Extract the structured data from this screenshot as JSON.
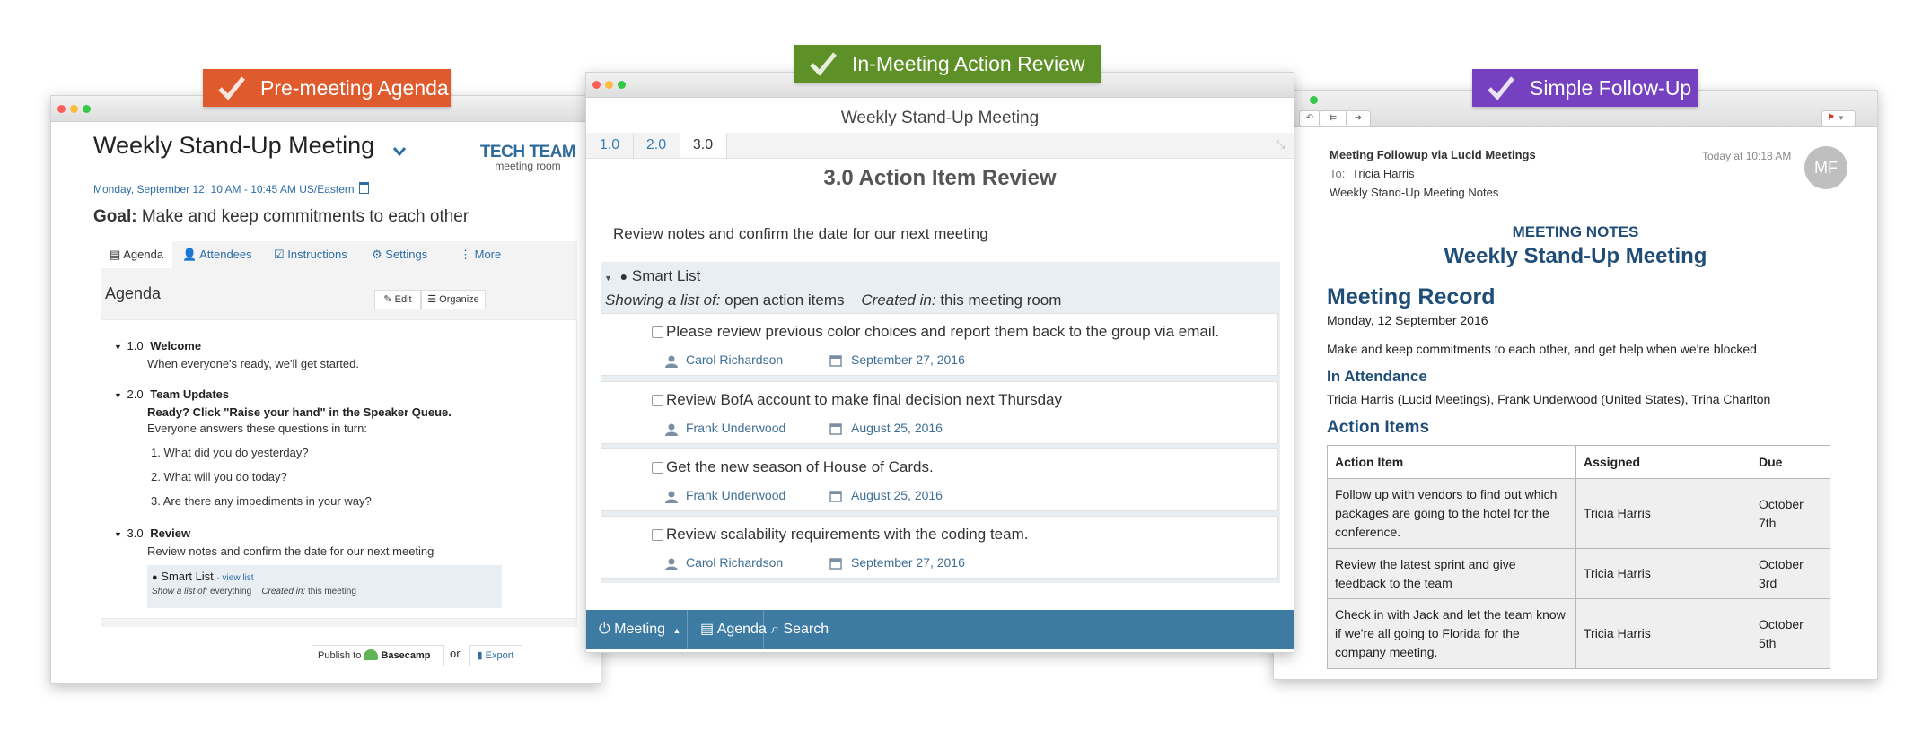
{
  "ribbons": {
    "left": {
      "label": "Pre-meeting Agenda",
      "color": "#df5a2d"
    },
    "center": {
      "label": "In-Meeting Action Review",
      "color": "#5d9026"
    },
    "right": {
      "label": "Simple Follow-Up",
      "color": "#7541c0"
    }
  },
  "agenda": {
    "title": "Weekly Stand-Up Meeting",
    "logo_main": "TECH TEAM",
    "logo_sub": "meeting room",
    "datetime": "Monday, September 12, 10 AM - 10:45 AM US/Eastern",
    "goal_label": "Goal:",
    "goal_text": "Make and keep commitments to each other",
    "tabs": [
      "Agenda",
      "Attendees",
      "Instructions",
      "Settings",
      "More"
    ],
    "panel_title": "Agenda",
    "edit_label": "Edit",
    "organize_label": "Organize",
    "items": [
      {
        "num": "1.0",
        "title": "Welcome",
        "desc": "When everyone's ready, we'll get started."
      },
      {
        "num": "2.0",
        "title": "Team Updates",
        "bold_desc": "Ready? Click \"Raise your hand\" in the Speaker Queue.",
        "desc": "Everyone answers these questions in turn:",
        "list": [
          "1. What did you do yesterday?",
          "2. What will you do today?",
          "3. Are there any impediments in your way?"
        ]
      },
      {
        "num": "3.0",
        "title": "Review",
        "desc": "Review notes and confirm the date for our next meeting"
      }
    ],
    "smart_list": {
      "label": "Smart List",
      "link": "· view list",
      "show_label": "Show a list of:",
      "show_value": "everything",
      "created_label": "Created in:",
      "created_value": "this meeting"
    },
    "publish_label": "Publish to",
    "basecamp_label": "Basecamp",
    "or_label": "or",
    "export_label": "Export"
  },
  "review": {
    "window_title": "Weekly Stand-Up Meeting",
    "tabs": [
      "1.0",
      "2.0",
      "3.0"
    ],
    "heading": "3.0 Action Item Review",
    "intro": "Review notes and confirm the date for our next meeting",
    "smart_list_label": "Smart List",
    "showing_label": "Showing a list of:",
    "showing_value": "open action items",
    "created_label": "Created in:",
    "created_value": "this meeting room",
    "items": [
      {
        "title": "Please review previous color choices and report them back to the group via email.",
        "person": "Carol Richardson",
        "date": "September 27, 2016"
      },
      {
        "title": "Review BofA account to make final decision next Thursday",
        "person": "Frank Underwood",
        "date": "August 25, 2016"
      },
      {
        "title": "Get the new season of House of Cards.",
        "person": "Frank Underwood",
        "date": "August 25, 2016"
      },
      {
        "title": "Review scalability requirements with the coding team.",
        "person": "Carol Richardson",
        "date": "September 27, 2016"
      }
    ],
    "bottom": {
      "meeting": "Meeting",
      "agenda": "Agenda",
      "search": "Search"
    }
  },
  "followup": {
    "from": "Meeting Followup via Lucid Meetings",
    "to_label": "To:",
    "to_value": "Tricia Harris",
    "subject": "Weekly Stand-Up Meeting Notes",
    "time": "Today at 10:18 AM",
    "avatar": "MF",
    "notes_label": "MEETING NOTES",
    "meeting_title": "Weekly Stand-Up Meeting",
    "record_heading": "Meeting Record",
    "record_date": "Monday, 12 September 2016",
    "goal": "Make and keep commitments to each other, and get help when we're blocked",
    "attendance_heading": "In Attendance",
    "attendance": "Tricia Harris (Lucid Meetings), Frank Underwood (United States), Trina Charlton",
    "action_heading": "Action Items",
    "table_headers": [
      "Action Item",
      "Assigned",
      "Due"
    ],
    "table_rows": [
      {
        "item": "Follow up with vendors to find out which packages are going to the hotel for the conference.",
        "assigned": "Tricia Harris",
        "due": "October 7th"
      },
      {
        "item": "Review the latest sprint and give feedback to the team",
        "assigned": "Tricia Harris",
        "due": "October 3rd"
      },
      {
        "item": "Check in with Jack and let the team know if we're all going to Florida for the company meeting.",
        "assigned": "Tricia Harris",
        "due": "October 5th"
      }
    ]
  }
}
